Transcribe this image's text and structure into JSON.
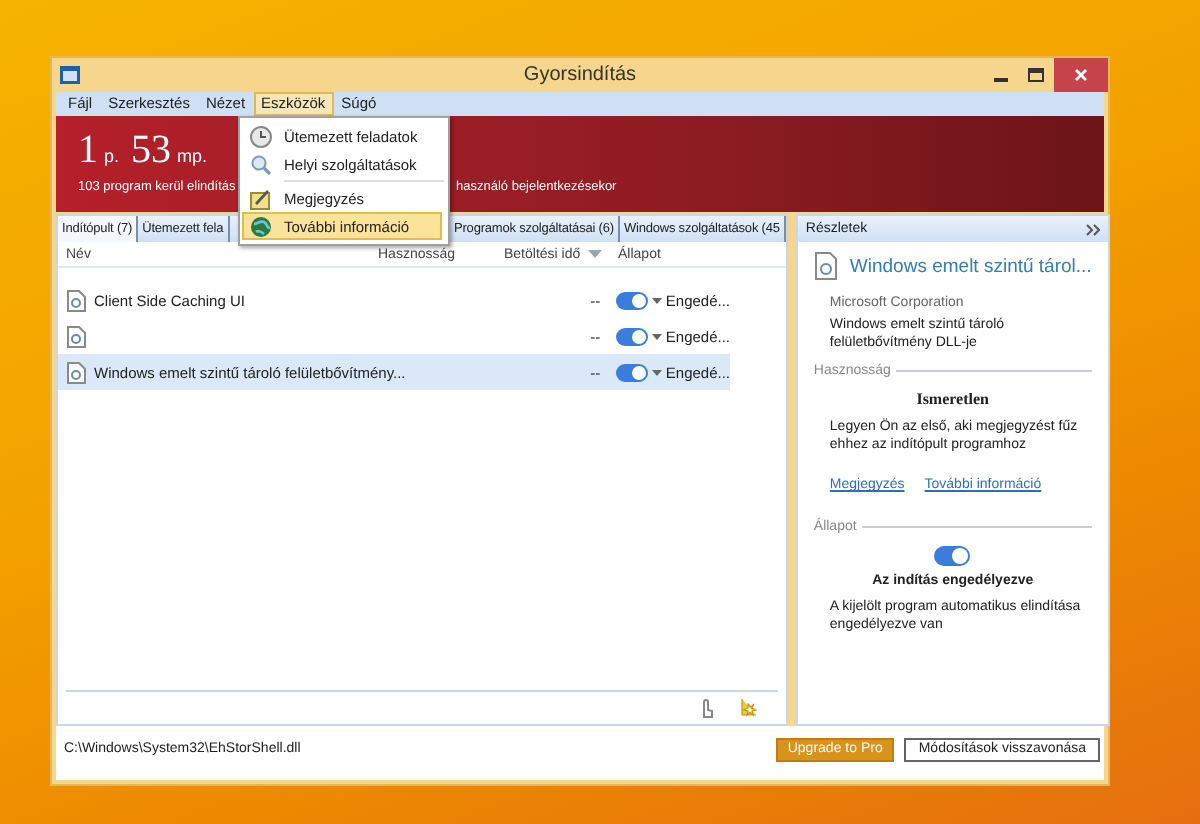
{
  "window": {
    "title": "Gyorsindítás"
  },
  "menu_bar": [
    {
      "label": "Fájl",
      "selected": false
    },
    {
      "label": "Szerkesztés",
      "selected": false
    },
    {
      "label": "Nézet",
      "selected": false
    },
    {
      "label": "Eszközök",
      "selected": true
    },
    {
      "label": "Súgó",
      "selected": false
    }
  ],
  "open_menu": {
    "groups": [
      [
        {
          "label": "Ütemezett feladatok",
          "kind": "clock",
          "selected": false
        },
        {
          "label": "Helyi szolgáltatások",
          "kind": "search",
          "selected": false
        }
      ],
      [
        {
          "label": "Megjegyzés",
          "kind": "note",
          "selected": false
        },
        {
          "label": "További információ",
          "kind": "globe",
          "selected": true
        }
      ]
    ]
  },
  "banner": {
    "minutes": "1",
    "minutes_unit": "p.",
    "seconds": "53",
    "seconds_unit": "mp.",
    "summary_start": "103 program kerül elindítás",
    "summary_end": "használó bejelentkezésekor"
  },
  "tabs": [
    {
      "label": "Indítópult (7)",
      "selected": true
    },
    {
      "label": "Ütemezett fela",
      "selected": false
    },
    {
      "label": "Programok szolgáltatásai (6)",
      "selected": false
    },
    {
      "label": "Windows szolgáltatások (45",
      "selected": false
    }
  ],
  "table": {
    "columns": [
      {
        "label": "Név",
        "sorted": false
      },
      {
        "label": "Hasznosság",
        "sorted": false
      },
      {
        "label": "Betöltési idő",
        "sorted": true
      },
      {
        "label": "Állapot",
        "sorted": false
      }
    ],
    "rows": [
      {
        "name": "Client Side Caching UI",
        "load_time": "--",
        "enabled": true,
        "status": "Engedé...",
        "selected": false
      },
      {
        "load_time": "--",
        "enabled": true,
        "status": "Engedé...",
        "selected": false
      },
      {
        "name": "Windows emelt szintű tároló felületbővítmény...",
        "load_time": "--",
        "enabled": true,
        "status": "Engedé...",
        "selected": true
      }
    ]
  },
  "details": {
    "header": "Részletek",
    "title": "Windows emelt szintű tárol...",
    "publisher": "Microsoft Corporation",
    "description": "Windows emelt szintű tároló felületbővítmény DLL-je",
    "usefulness_heading": "Hasznosság",
    "rating": "Ismeretlen",
    "rating_note": "Legyen Ön az első, aki megjegyzést fűz ehhez az indítópult programhoz",
    "links": [
      "Megjegyzés",
      "További információ"
    ],
    "status_heading": "Állapot",
    "enabled": true,
    "status_title": "Az indítás engedélyezve",
    "status_note": "A kijelölt program automatikus elindítása engedélyezve van"
  },
  "status_bar": {
    "path": "C:\\Windows\\System32\\EhStorShell.dll",
    "buttons": [
      {
        "label": "Upgrade to Pro",
        "kind": "primary"
      },
      {
        "label": "Módosítások visszavonása",
        "kind": "secondary"
      }
    ]
  }
}
